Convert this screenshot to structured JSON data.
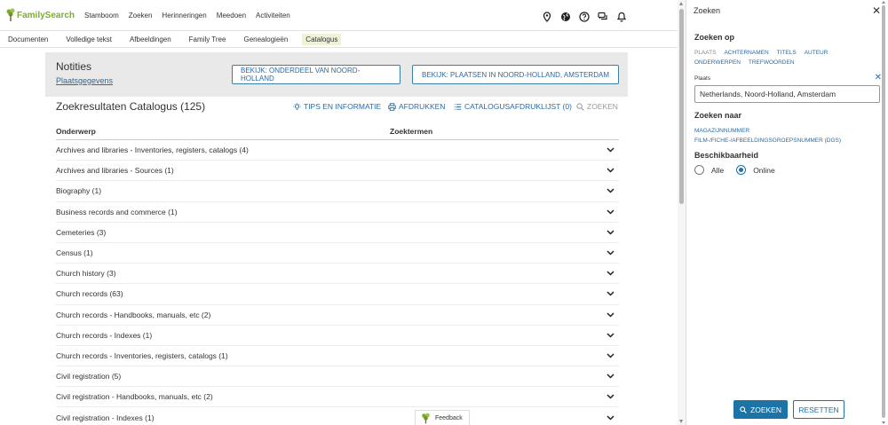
{
  "brand": {
    "name": "FamilySearch",
    "color": "#7bad2a"
  },
  "nav": {
    "links": [
      "Stamboom",
      "Zoeken",
      "Herinneringen",
      "Meedoen",
      "Activiteiten"
    ],
    "icons": [
      "location-pin-icon",
      "globe-icon",
      "help-icon",
      "chat-icon",
      "bell-icon"
    ]
  },
  "subnav": {
    "items": [
      "Documenten",
      "Volledige tekst",
      "Afbeeldingen",
      "Family Tree",
      "Genealogieën",
      "Catalogus"
    ],
    "active": "Catalogus"
  },
  "notes": {
    "title": "Notities",
    "link": "Plaatsgegevens",
    "button1": "BEKIJK: ONDERDEEL VAN NOORD-HOLLAND",
    "button2": "BEKIJK: PLAATSEN IN NOORD-HOLLAND, AMSTERDAM"
  },
  "results": {
    "title": "Zoekresultaten Catalogus (125)",
    "toolbar": {
      "tips": "TIPS EN INFORMATIE",
      "print": "AFDRUKKEN",
      "list": "CATALOGUSAFDRUKLIJST (0)",
      "search": "ZOEKEN"
    },
    "col_subject": "Onderwerp",
    "col_terms": "Zoektermen",
    "rows": [
      "Archives and libraries - Inventories, registers, catalogs (4)",
      "Archives and libraries - Sources (1)",
      "Biography (1)",
      "Business records and commerce (1)",
      "Cemeteries (3)",
      "Census (1)",
      "Church history (3)",
      "Church records (63)",
      "Church records - Handbooks, manuals, etc (2)",
      "Church records - Indexes (1)",
      "Church records - Inventories, registers, catalogs (1)",
      "Civil registration (5)",
      "Civil registration - Handbooks, manuals, etc (2)",
      "Civil registration - Indexes (1)"
    ]
  },
  "feedback": {
    "label": "Feedback"
  },
  "panel": {
    "title": "Zoeken",
    "search_on": "Zoeken op",
    "tabs": [
      "PLAATS",
      "ACHTERNAMEN",
      "TITELS",
      "AUTEUR",
      "ONDERWERPEN",
      "TREFWOORDEN"
    ],
    "place_label": "Plaats",
    "place_value": "Netherlands, Noord-Holland, Amsterdam",
    "search_for": "Zoeken naar",
    "search_links": [
      "MAGAZIJNNUMMER",
      "FILM-/FICHE-/AFBEELDINGSGROEPSNUMMER (DGS)"
    ],
    "availability": "Beschikbaarheid",
    "radio_all": "Alle",
    "radio_online": "Online",
    "selected": "Online",
    "btn_search": "ZOEKEN",
    "btn_reset": "RESETTEN"
  },
  "colors": {
    "accent": "#1d72a6",
    "link": "#2c6aa0"
  }
}
